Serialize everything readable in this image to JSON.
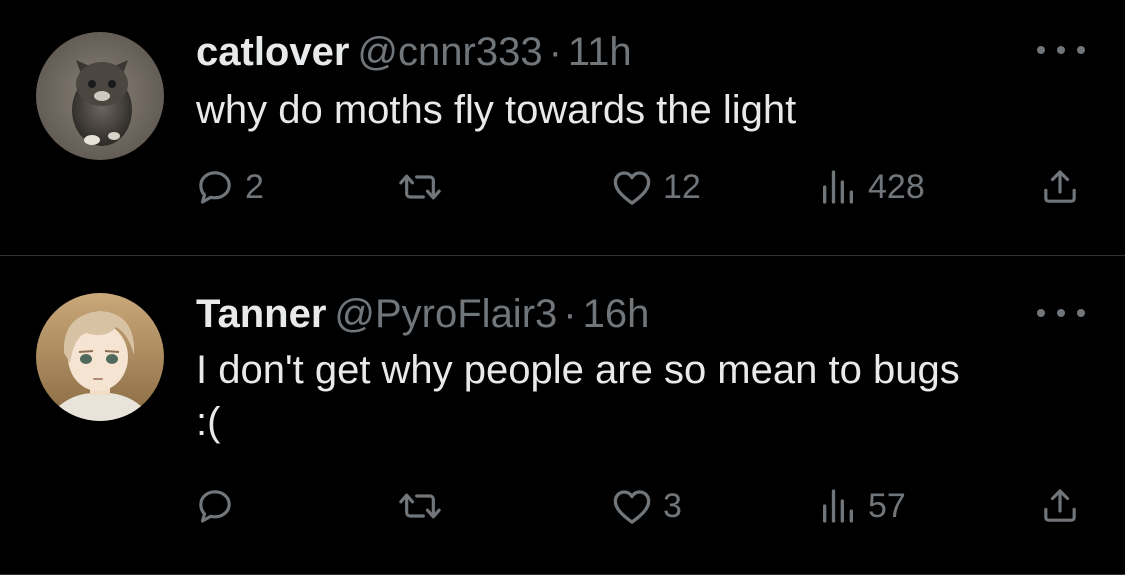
{
  "tweets": [
    {
      "display_name": "catlover",
      "handle": "@cnnr333",
      "separator": "·",
      "time": "11h",
      "text_lines": [
        "why do moths fly towards the light"
      ],
      "avatar_icon": "kitten-avatar",
      "reply_count": "2",
      "retweet_count": "",
      "like_count": "12",
      "view_count": "428"
    },
    {
      "display_name": "Tanner",
      "handle": "@PyroFlair3",
      "separator": "·",
      "time": "16h",
      "text_lines": [
        "I don't get why people are so mean to bugs",
        ":("
      ],
      "avatar_icon": "anime-boy-avatar",
      "reply_count": "",
      "retweet_count": "",
      "like_count": "3",
      "view_count": "57"
    }
  ],
  "icons": {
    "reply": "reply-icon",
    "retweet": "retweet-icon",
    "like": "heart-icon",
    "views": "views-icon",
    "share": "share-icon",
    "more": "more-icon"
  },
  "colors": {
    "background": "#000000",
    "primary_text": "#e7e9ea",
    "secondary_text": "#71767b",
    "divider": "#2f3336"
  }
}
